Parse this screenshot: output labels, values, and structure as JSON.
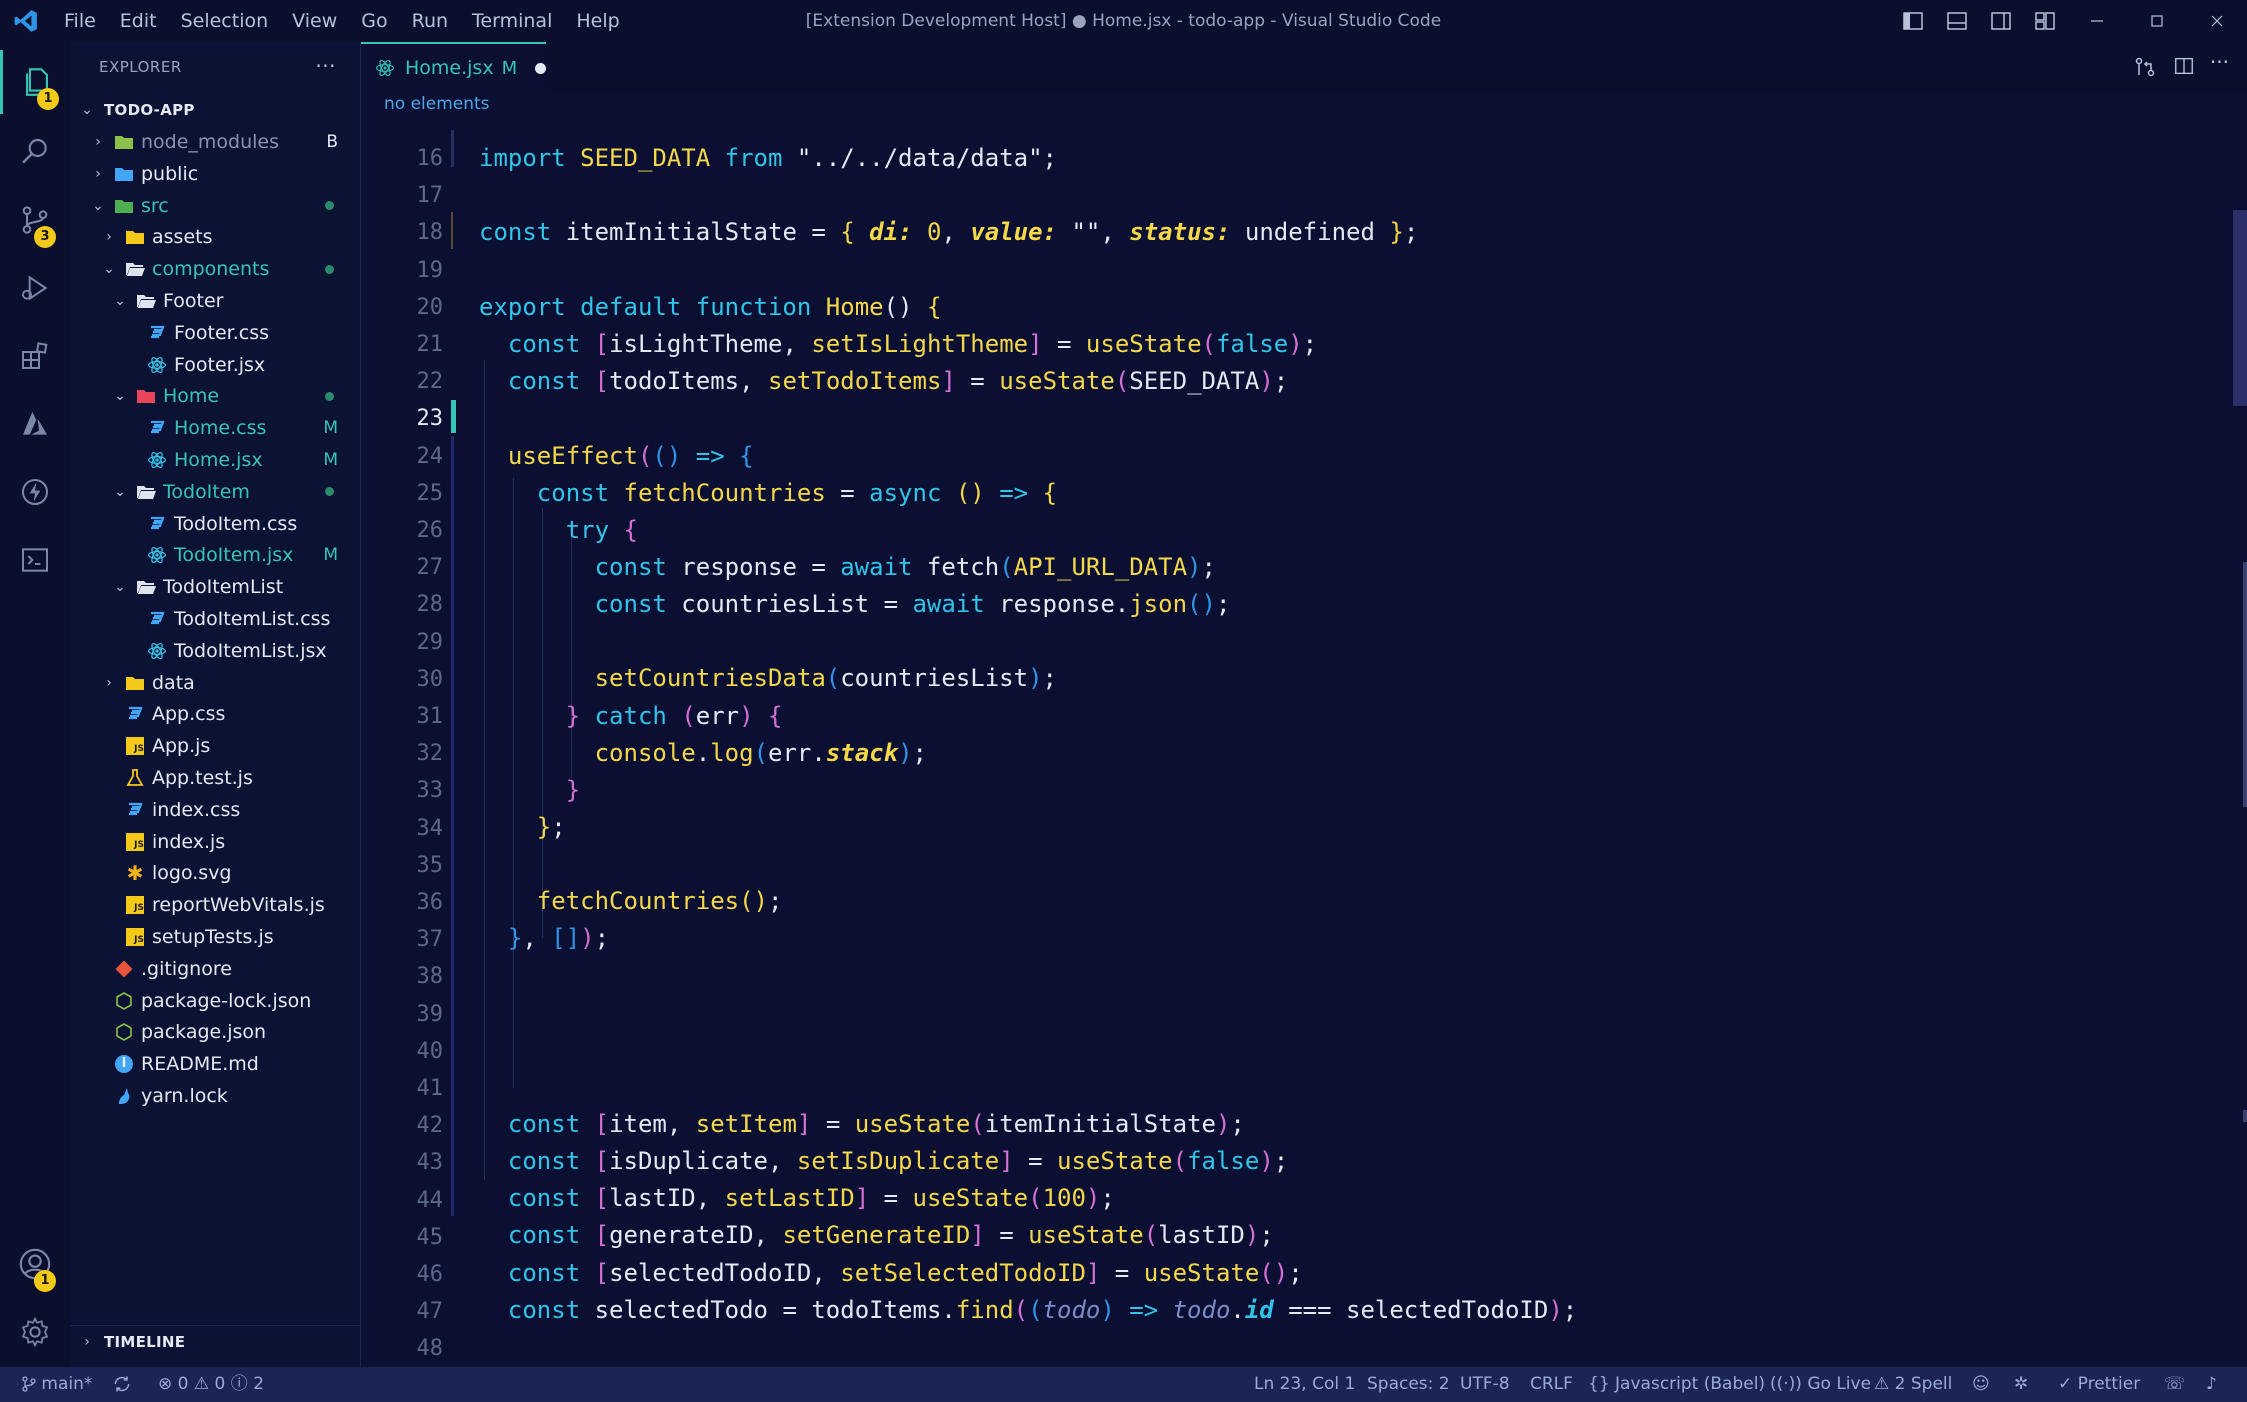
{
  "titlebar": {
    "menu": [
      "File",
      "Edit",
      "Selection",
      "View",
      "Go",
      "Run",
      "Terminal",
      "Help"
    ],
    "title": "[Extension Development Host] ● Home.jsx - todo-app - Visual Studio Code"
  },
  "activitybar": {
    "explorer_badge": "1",
    "scm_badge": "3",
    "accounts_badge": "1"
  },
  "explorer": {
    "header": "EXPLORER",
    "more": "···",
    "root": "TODO-APP",
    "items": [
      {
        "label": "node_modules",
        "status": "B"
      },
      {
        "label": "public",
        "status": ""
      },
      {
        "label": "src",
        "status": ""
      },
      {
        "label": "assets",
        "status": ""
      },
      {
        "label": "components",
        "status": ""
      },
      {
        "label": "Footer",
        "status": ""
      },
      {
        "label": "Footer.css",
        "status": ""
      },
      {
        "label": "Footer.jsx",
        "status": ""
      },
      {
        "label": "Home",
        "status": ""
      },
      {
        "label": "Home.css",
        "status": "M"
      },
      {
        "label": "Home.jsx",
        "status": "M"
      },
      {
        "label": "TodoItem",
        "status": ""
      },
      {
        "label": "TodoItem.css",
        "status": ""
      },
      {
        "label": "TodoItem.jsx",
        "status": "M"
      },
      {
        "label": "TodoItemList",
        "status": ""
      },
      {
        "label": "TodoItemList.css",
        "status": ""
      },
      {
        "label": "TodoItemList.jsx",
        "status": ""
      },
      {
        "label": "data",
        "status": ""
      },
      {
        "label": "App.css",
        "status": ""
      },
      {
        "label": "App.js",
        "status": ""
      },
      {
        "label": "App.test.js",
        "status": ""
      },
      {
        "label": "index.css",
        "status": ""
      },
      {
        "label": "index.js",
        "status": ""
      },
      {
        "label": "logo.svg",
        "status": ""
      },
      {
        "label": "reportWebVitals.js",
        "status": ""
      },
      {
        "label": "setupTests.js",
        "status": ""
      },
      {
        "label": ".gitignore",
        "status": ""
      },
      {
        "label": "package-lock.json",
        "status": ""
      },
      {
        "label": "package.json",
        "status": ""
      },
      {
        "label": "README.md",
        "status": ""
      },
      {
        "label": "yarn.lock",
        "status": ""
      }
    ],
    "timeline": "TIMELINE"
  },
  "editor": {
    "tab_label": "Home.jsx",
    "tab_status": "M",
    "breadcrumb": "no elements",
    "line_numbers": [
      "16",
      "17",
      "18",
      "19",
      "20",
      "21",
      "22",
      "23",
      "24",
      "25",
      "26",
      "27",
      "28",
      "29",
      "30",
      "31",
      "32",
      "33",
      "34",
      "35",
      "36",
      "37",
      "38",
      "39",
      "40",
      "41",
      "42",
      "43",
      "44",
      "45",
      "46",
      "47",
      "48"
    ],
    "active_line": "23"
  },
  "statusbar": {
    "branch": "main*",
    "errors": "0",
    "warnings": "0",
    "info": "2",
    "position": "Ln 23, Col 1",
    "spaces": "Spaces: 2",
    "encoding": "UTF-8",
    "eol": "CRLF",
    "language": "Javascript (Babel)",
    "golive": "Go Live",
    "spell": "2 Spell",
    "prettier": "Prettier"
  },
  "colors": {
    "background": "#0b1033",
    "accent": "#36c5b3",
    "keyword": "#30c5e8",
    "function": "#f5d849",
    "badge": "#f3c91a"
  }
}
